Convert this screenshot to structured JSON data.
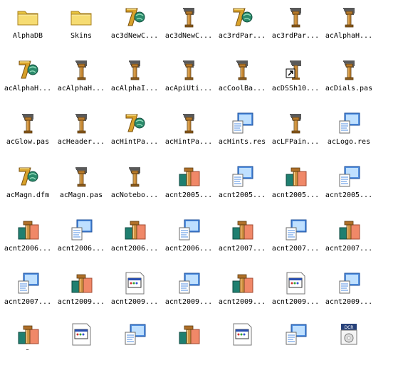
{
  "files": [
    {
      "name": "AlphaDB",
      "icon": "folder-icon"
    },
    {
      "name": "Skins",
      "icon": "folder-icon"
    },
    {
      "name": "ac3dNewC...",
      "icon": "delphi-form-icon"
    },
    {
      "name": "ac3dNewC...",
      "icon": "delphi-unit-icon"
    },
    {
      "name": "ac3rdPar...",
      "icon": "delphi-form-icon"
    },
    {
      "name": "ac3rdPar...",
      "icon": "delphi-unit-icon"
    },
    {
      "name": "acAlphaH...",
      "icon": "delphi-unit-icon"
    },
    {
      "name": "acAlphaH...",
      "icon": "delphi-form-icon"
    },
    {
      "name": "acAlphaH...",
      "icon": "delphi-unit-icon"
    },
    {
      "name": "acAlphaI...",
      "icon": "delphi-unit-icon"
    },
    {
      "name": "acApiUti...",
      "icon": "delphi-unit-icon"
    },
    {
      "name": "acCoolBa...",
      "icon": "delphi-unit-icon"
    },
    {
      "name": "acDSSh10...",
      "icon": "delphi-unit-shortcut-icon"
    },
    {
      "name": "acDials.pas",
      "icon": "delphi-unit-icon"
    },
    {
      "name": "acGlow.pas",
      "icon": "delphi-unit-icon"
    },
    {
      "name": "acHeader...",
      "icon": "delphi-unit-icon"
    },
    {
      "name": "acHintPa...",
      "icon": "delphi-form-icon"
    },
    {
      "name": "acHintPa...",
      "icon": "delphi-unit-icon"
    },
    {
      "name": "acHints.res",
      "icon": "resource-file-icon"
    },
    {
      "name": "acLFPain...",
      "icon": "delphi-unit-icon"
    },
    {
      "name": "acLogo.res",
      "icon": "resource-file-icon"
    },
    {
      "name": "acMagn.dfm",
      "icon": "delphi-form-icon"
    },
    {
      "name": "acMagn.pas",
      "icon": "delphi-unit-icon"
    },
    {
      "name": "acNotebo...",
      "icon": "delphi-unit-icon"
    },
    {
      "name": "acnt2005...",
      "icon": "delphi-package-icon"
    },
    {
      "name": "acnt2005...",
      "icon": "resource-file-icon"
    },
    {
      "name": "acnt2005...",
      "icon": "delphi-package-icon"
    },
    {
      "name": "acnt2005...",
      "icon": "resource-file-icon"
    },
    {
      "name": "acnt2006...",
      "icon": "delphi-package-icon"
    },
    {
      "name": "acnt2006...",
      "icon": "resource-file-icon"
    },
    {
      "name": "acnt2006...",
      "icon": "delphi-package-icon"
    },
    {
      "name": "acnt2006...",
      "icon": "resource-file-icon"
    },
    {
      "name": "acnt2007...",
      "icon": "delphi-package-icon"
    },
    {
      "name": "acnt2007...",
      "icon": "resource-file-icon"
    },
    {
      "name": "acnt2007...",
      "icon": "delphi-package-icon"
    },
    {
      "name": "acnt2007...",
      "icon": "resource-file-icon"
    },
    {
      "name": "acnt2009...",
      "icon": "delphi-package-icon"
    },
    {
      "name": "acnt2009...",
      "icon": "dialog-file-icon"
    },
    {
      "name": "acnt2009...",
      "icon": "resource-file-icon"
    },
    {
      "name": "acnt2009...",
      "icon": "delphi-package-icon"
    },
    {
      "name": "acnt2009...",
      "icon": "dialog-file-icon"
    },
    {
      "name": "acnt2009...",
      "icon": "resource-file-icon"
    },
    {
      "name": "",
      "icon": "delphi-package-icon",
      "selected": true
    },
    {
      "name": "",
      "icon": "dialog-file-icon"
    },
    {
      "name": "",
      "icon": "resource-file-icon"
    },
    {
      "name": "",
      "icon": "delphi-package-icon"
    },
    {
      "name": "",
      "icon": "dialog-file-icon"
    },
    {
      "name": "",
      "icon": "resource-file-icon"
    },
    {
      "name": "",
      "icon": "dcr-file-icon"
    }
  ]
}
